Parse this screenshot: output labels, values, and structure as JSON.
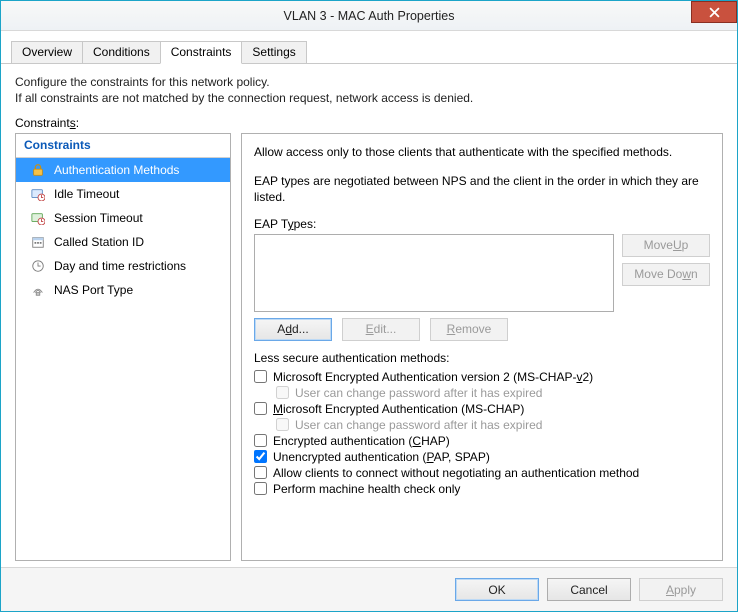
{
  "window": {
    "title": "VLAN 3 - MAC Auth Properties"
  },
  "tabs": {
    "items": [
      {
        "label": "Overview",
        "active": false
      },
      {
        "label": "Conditions",
        "active": false
      },
      {
        "label": "Constraints",
        "active": true
      },
      {
        "label": "Settings",
        "active": false
      }
    ]
  },
  "intro": {
    "line1": "Configure the constraints for this network policy.",
    "line2": "If all constraints are not matched by the connection request, network access is denied."
  },
  "constraints_label": "Constraints:",
  "left": {
    "header": "Constraints",
    "items": [
      {
        "label": "Authentication Methods",
        "icon": "lock",
        "selected": true
      },
      {
        "label": "Idle Timeout",
        "icon": "idle",
        "selected": false
      },
      {
        "label": "Session Timeout",
        "icon": "session",
        "selected": false
      },
      {
        "label": "Called Station ID",
        "icon": "calendar",
        "selected": false
      },
      {
        "label": "Day and time restrictions",
        "icon": "clock",
        "selected": false
      },
      {
        "label": "NAS Port Type",
        "icon": "nas",
        "selected": false
      }
    ]
  },
  "right": {
    "allow_text": "Allow access only to those clients that authenticate with the specified methods.",
    "eap_intro": "EAP types are negotiated between NPS and the client in the order in which they are listed.",
    "eap_label": "EAP Types:",
    "buttons": {
      "move_up": "Move Up",
      "move_down": "Move Down",
      "add": "Add...",
      "edit": "Edit...",
      "remove": "Remove"
    },
    "less_secure_label": "Less secure authentication methods:",
    "checks": {
      "mschap_v2": "Microsoft Encrypted Authentication version 2 (MS-CHAP-v2)",
      "mschap_v2_sub": "User can change password after it has expired",
      "mschap": "Microsoft Encrypted Authentication (MS-CHAP)",
      "mschap_sub": "User can change password after it has expired",
      "chap": "Encrypted authentication (CHAP)",
      "pap": "Unencrypted authentication (PAP, SPAP)",
      "no_negotiate": "Allow clients to connect without negotiating an authentication method",
      "health_only": "Perform machine health check only"
    },
    "checked": {
      "mschap_v2": false,
      "mschap_v2_sub": false,
      "mschap": false,
      "mschap_sub": false,
      "chap": false,
      "pap": true,
      "no_negotiate": false,
      "health_only": false
    }
  },
  "footer": {
    "ok": "OK",
    "cancel": "Cancel",
    "apply": "Apply"
  }
}
